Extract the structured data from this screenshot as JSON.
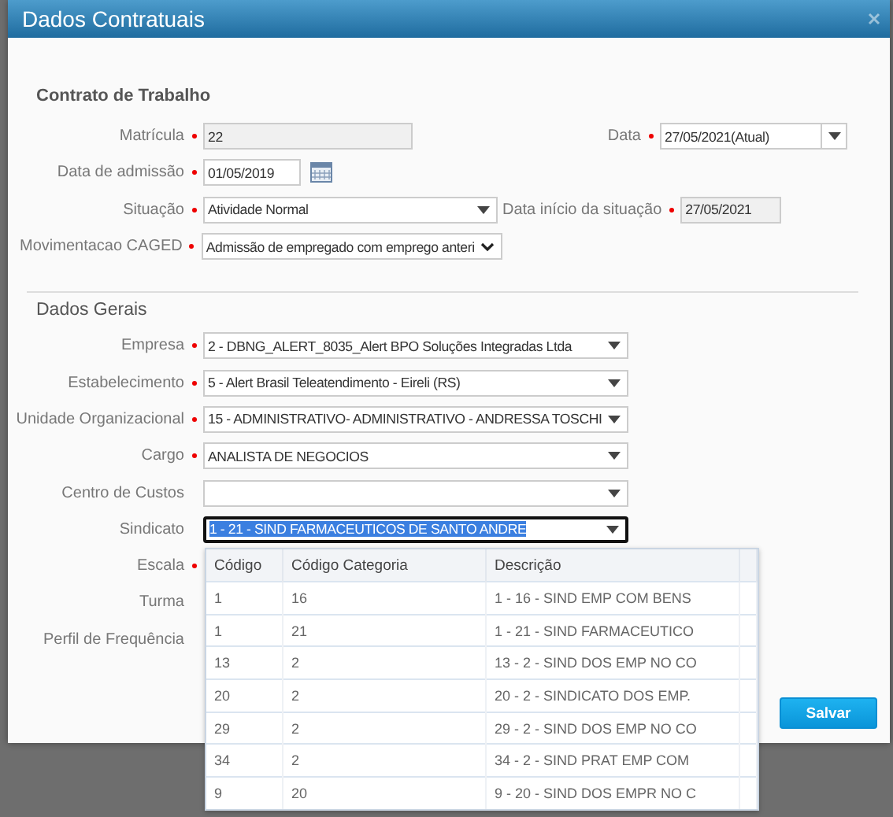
{
  "dialog": {
    "title": "Dados Contratuais"
  },
  "sections": [
    {
      "title": "Contrato de Trabalho",
      "rows": [
        [
          {
            "label": "Matrícula",
            "required": true,
            "kind": "readonly",
            "value": "22"
          },
          {
            "label": "Data",
            "required": true,
            "kind": "combo",
            "value": "27/05/2021(Atual)"
          }
        ],
        [
          {
            "label": "Data de admissão",
            "required": true,
            "kind": "date",
            "value": "01/05/2019"
          }
        ],
        [
          {
            "label": "Situação",
            "required": true,
            "kind": "select",
            "value": "Atividade Normal"
          },
          {
            "label": "Data início da situação",
            "required": true,
            "kind": "readonly",
            "value": "27/05/2021"
          }
        ],
        [
          {
            "label": "Movimentacao CAGED",
            "required": true,
            "kind": "native",
            "value": "Admissão de empregado com emprego anteri"
          }
        ]
      ]
    },
    {
      "title": "Dados Gerais",
      "rows": [
        [
          {
            "label": "Empresa",
            "required": true,
            "kind": "select",
            "value": "2 - DBNG_ALERT_8035_Alert BPO Soluções Integradas Ltda",
            "focused": false
          }
        ],
        [
          {
            "label": "Estabelecimento",
            "required": true,
            "kind": "select",
            "value": "5 - Alert Brasil Teleatendimento - Eireli (RS)",
            "focused": false
          }
        ],
        [
          {
            "label": "Unidade Organizacional",
            "required": true,
            "kind": "select",
            "value": "15 - ADMINISTRATIVO- ADMINISTRATIVO - ANDRESSA TOSCHI",
            "focused": false
          }
        ],
        [
          {
            "label": "Cargo",
            "required": true,
            "kind": "select",
            "value": "ANALISTA DE NEGOCIOS",
            "focused": false
          }
        ],
        [
          {
            "label": "Centro de Custos",
            "required": false,
            "kind": "select",
            "focused": false
          }
        ],
        [
          {
            "label": "Sindicato",
            "required": false,
            "kind": "select",
            "value": "1 - 21 - SIND FARMACEUTICOS DE SANTO ANDRE",
            "focused": true
          }
        ],
        [
          {
            "label": "Escala",
            "required": true
          }
        ],
        [
          {
            "label": "Turma",
            "required": false
          }
        ],
        [
          {
            "label": "Perfil de Frequência",
            "required": false
          }
        ]
      ]
    }
  ],
  "dropdown": {
    "columns": [
      "Código",
      "Código Categoria",
      "Descrição"
    ],
    "rows": [
      [
        "1",
        "16",
        "1 - 16 - SIND EMP COM BENS"
      ],
      [
        "1",
        "21",
        "1 - 21 - SIND FARMACEUTICO"
      ],
      [
        "13",
        "2",
        "13 - 2 - SIND DOS EMP NO CO"
      ],
      [
        "20",
        "2",
        "20 - 2 - SINDICATO DOS EMP."
      ],
      [
        "29",
        "2",
        "29 - 2 - SIND DOS EMP NO CO"
      ],
      [
        "34",
        "2",
        "34 - 2 - SIND PRAT EMP COM"
      ],
      [
        "9",
        "20",
        "9 - 20 - SIND DOS EMPR NO C"
      ]
    ]
  },
  "buttons": [
    {
      "label": "Salvar",
      "kind": "primary"
    }
  ]
}
